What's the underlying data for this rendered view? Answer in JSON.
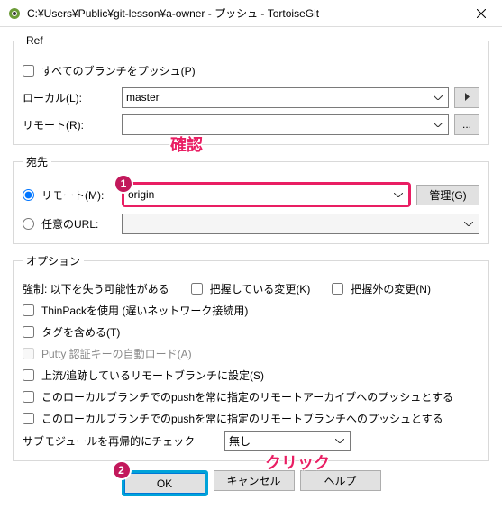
{
  "title": "C:¥Users¥Public¥git-lesson¥a-owner - プッシュ - TortoiseGit",
  "ref": {
    "legend": "Ref",
    "push_all": "すべてのブランチをプッシュ(P)",
    "local_label": "ローカル(L):",
    "local_value": "master",
    "remote_label": "リモート(R):"
  },
  "dest": {
    "legend": "宛先",
    "remote_radio": "リモート(M):",
    "remote_value": "origin",
    "manage": "管理(G)",
    "url_radio": "任意のURL:"
  },
  "opt": {
    "legend": "オプション",
    "force_label": "強制: 以下を失う可能性がある",
    "known_changes": "把握している変更(K)",
    "unknown_changes": "把握外の変更(N)",
    "thinpack": "ThinPackを使用 (遅いネットワーク接続用)",
    "include_tags": "タグを含める(T)",
    "putty": "Putty 認証キーの自動ロード(A)",
    "set_upstream": "上流/追跡しているリモートブランチに設定(S)",
    "always_archive": "このローカルブランチでのpushを常に指定のリモートアーカイブへのプッシュとする",
    "always_branch": "このローカルブランチでのpushを常に指定のリモートブランチへのプッシュとする",
    "submodule_label": "サブモジュールを再帰的にチェック",
    "submodule_value": "無し"
  },
  "buttons": {
    "ok": "OK",
    "cancel": "キャンセル",
    "help": "ヘルプ"
  },
  "annotations": {
    "confirm": "確認",
    "click": "クリック",
    "badge1": "1",
    "badge2": "2"
  }
}
